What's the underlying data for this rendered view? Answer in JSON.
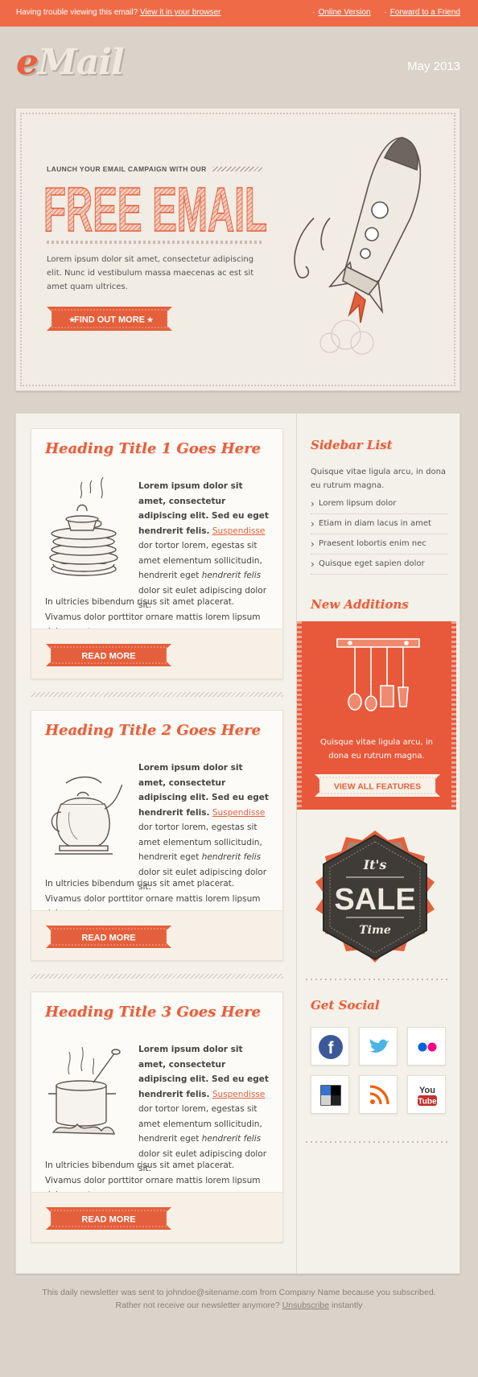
{
  "topbar": {
    "trouble_text": "Having trouble viewing this email?",
    "view_link": "View it in your browser",
    "online_version": "Online Version",
    "forward": "Forward to a Friend"
  },
  "header": {
    "logo_e": "e",
    "logo_rest": "Mail",
    "date": "May 2013"
  },
  "hero": {
    "kicker": "LAUNCH YOUR EMAIL CAMPAIGN WITH OUR",
    "headline": "FREE EMAIL",
    "lead": "Lorem ipsum dolor sit amet, consectetur adipiscing elit. Nunc id vestibulum massa maecenas ac est sit amet quam ultrices.",
    "cta": "FIND OUT MORE"
  },
  "articles": [
    {
      "title": "Heading Title 1 Goes Here",
      "p1_a": "Lorem ipsum dolor sit amet, consectetur adipiscing elit. Sed eu eget hendrerit felis.",
      "p1_link": "Suspendisse",
      "p1_b": "dor tortor lorem, egestas sit amet elementum sollicitudin, hendrerit eget",
      "p1_italic": "hendrerit felis",
      "p1_c": "dolor sit eulet adipiscing dolor sit.",
      "p2": "In ultricies bibendum risus sit amet placerat. Vivamus dolor porttitor ornare mattis lorem lipsum dolor amet.",
      "button": "READ MORE",
      "icon": "dishes-icon"
    },
    {
      "title": "Heading Title 2 Goes Here",
      "p1_a": "Lorem ipsum dolor sit amet, consectetur adipiscing elit. Sed eu eget hendrerit felis.",
      "p1_link": "Suspendisse",
      "p1_b": "dor tortor lorem, egestas sit amet elementum sollicitudin, hendrerit eget",
      "p1_italic": "hendrerit felis",
      "p1_c": "dolor sit eulet adipiscing dolor sit.",
      "p2": "In ultricies bibendum risus sit amet placerat. Vivamus dolor porttitor ornare mattis lorem lipsum dolor amet.",
      "button": "READ MORE",
      "icon": "teapot-icon"
    },
    {
      "title": "Heading Title 3 Goes Here",
      "p1_a": "Lorem ipsum dolor sit amet, consectetur adipiscing elit. Sed eu eget hendrerit felis.",
      "p1_link": "Suspendisse",
      "p1_b": "dor tortor lorem, egestas sit amet elementum sollicitudin, hendrerit eget",
      "p1_italic": "hendrerit felis",
      "p1_c": "dolor sit eulet adipiscing dolor sit.",
      "p2": "In ultricies bibendum risus sit amet placerat. Vivamus dolor porttitor ornare mattis lorem lipsum dolor amet.",
      "button": "READ MORE",
      "icon": "cooking-pot-icon"
    }
  ],
  "sidebar": {
    "list_title": "Sidebar List",
    "list_intro": "Quisque vitae ligula arcu, in dona eu rutrum magna.",
    "items": [
      "Lorem lipsum dolor",
      "Etiam in diam lacus in amet",
      "Praesent lobortis enim nec",
      "Quisque eget sapien dolor"
    ],
    "new_title": "New Additions",
    "new_text": "Quisque vitae ligula arcu, in dona eu rutrum magna.",
    "new_button": "VIEW ALL FEATURES",
    "sale_top": "It's",
    "sale_mid": "SALE",
    "sale_bottom": "Time",
    "social_title": "Get Social",
    "social_icons": [
      "facebook-icon",
      "twitter-icon",
      "flickr-icon",
      "delicious-icon",
      "rss-icon",
      "youtube-icon"
    ]
  },
  "footer": {
    "line1": "This daily newsletter was sent to johndoe@sitename.com from Company Name because you subscribed.",
    "line2_a": "Rather not receive our newsletter anymore?",
    "unsubscribe": "Unsubscribe",
    "line2_b": "instantly"
  },
  "colors": {
    "accent": "#ef6b48",
    "background": "#d9d3ca",
    "panel": "#f4f1ea"
  }
}
